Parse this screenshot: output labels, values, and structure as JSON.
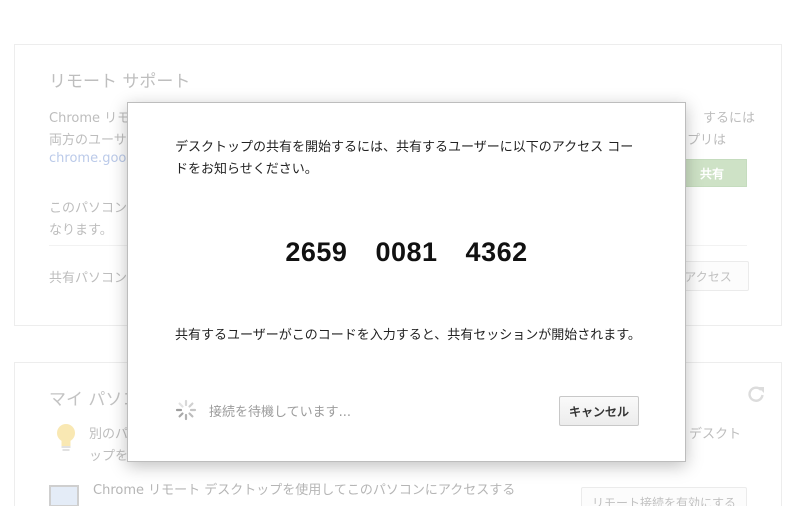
{
  "background": {
    "remote_support": {
      "title": "リモート サポート",
      "line1_left": "Chrome リモ",
      "line1_right": "するには",
      "line2_left": "両方のユーサ",
      "line2_right": "プリは",
      "link_partial": "chrome.goog",
      "line4_left": "このパソコン",
      "line5_left": "なります。",
      "share_button": "共有",
      "line6_left": "共有パソコン",
      "access_button": "アクセス"
    },
    "my_computers": {
      "title": "マイ パソコ",
      "line1_left": "別のパ",
      "line1_right": "デスクト",
      "line2_left": "ップを",
      "line3": "Chrome リモート デスクトップを使用してこのパソコンにアクセスする",
      "enable_button": "リモート接続を有効にする"
    }
  },
  "dialog": {
    "instruction": "デスクトップの共有を開始するには、共有するユーザーに以下のアクセス コードをお知らせください。",
    "code_parts": [
      "2659",
      "0081",
      "4362"
    ],
    "code_part1": "2659",
    "code_part2": "0081",
    "code_part3": "4362",
    "followup": "共有するユーザーがこのコードを入力すると、共有セッションが開始されます。",
    "status": "接続を待機しています...",
    "cancel_button": "キャンセル"
  },
  "icons": {
    "spinner": "spinner-icon",
    "refresh": "refresh-icon",
    "bulb": "lightbulb-icon",
    "monitor": "monitor-icon"
  },
  "colors": {
    "share_button": "#b4d3a8",
    "link": "#97aede",
    "dialog_border": "#bdbdbd"
  }
}
